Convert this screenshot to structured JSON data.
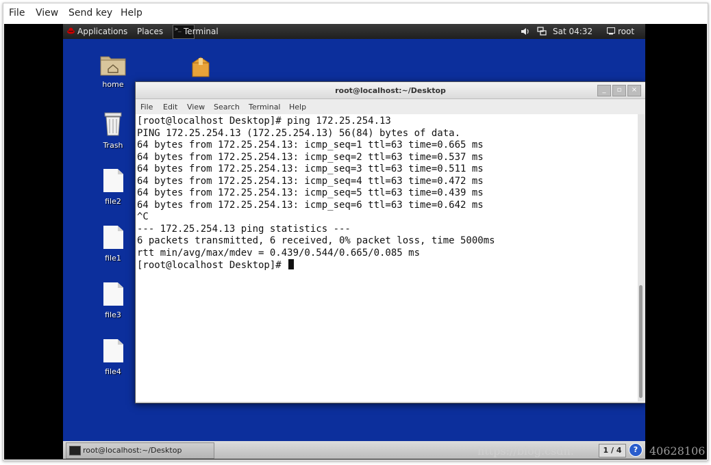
{
  "viewer": {
    "menu": [
      "File",
      "View",
      "Send key",
      "Help"
    ]
  },
  "top_panel": {
    "applications": "Applications",
    "places": "Places",
    "terminal": "Terminal",
    "clock": "Sat 04:32",
    "user": "root",
    "icons": [
      "volume-icon",
      "network-icon",
      "user-icon"
    ]
  },
  "desktop_icons": [
    {
      "label": "home",
      "icon": "home-folder-icon"
    },
    {
      "label": "Trash",
      "icon": "trash-icon"
    },
    {
      "label": "file2",
      "icon": "file-icon"
    },
    {
      "label": "file1",
      "icon": "file-icon"
    },
    {
      "label": "file3",
      "icon": "file-icon"
    },
    {
      "label": "file4",
      "icon": "file-icon"
    },
    {
      "label": "",
      "icon": "package-icon"
    }
  ],
  "terminal": {
    "title": "root@localhost:~/Desktop",
    "menu": [
      "File",
      "Edit",
      "View",
      "Search",
      "Terminal",
      "Help"
    ],
    "lines": [
      "[root@localhost Desktop]# ping 172.25.254.13",
      "PING 172.25.254.13 (172.25.254.13) 56(84) bytes of data.",
      "64 bytes from 172.25.254.13: icmp_seq=1 ttl=63 time=0.665 ms",
      "64 bytes from 172.25.254.13: icmp_seq=2 ttl=63 time=0.537 ms",
      "64 bytes from 172.25.254.13: icmp_seq=3 ttl=63 time=0.511 ms",
      "64 bytes from 172.25.254.13: icmp_seq=4 ttl=63 time=0.472 ms",
      "64 bytes from 172.25.254.13: icmp_seq=5 ttl=63 time=0.439 ms",
      "64 bytes from 172.25.254.13: icmp_seq=6 ttl=63 time=0.642 ms",
      "^C",
      "--- 172.25.254.13 ping statistics ---",
      "6 packets transmitted, 6 received, 0% packet loss, time 5000ms",
      "rtt min/avg/max/mdev = 0.439/0.544/0.665/0.085 ms",
      "[root@localhost Desktop]# "
    ]
  },
  "taskbar": {
    "task_label": "root@localhost:~/Desktop",
    "pager": "1 / 4",
    "help": "?"
  },
  "watermark": {
    "url": "https://blog.csdn.",
    "id": "40628106"
  }
}
